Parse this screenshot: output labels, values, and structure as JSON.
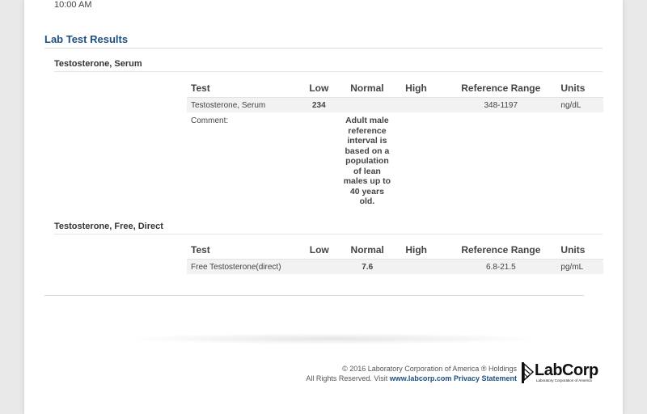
{
  "header": {
    "time": "10:00 AM"
  },
  "section": {
    "title": "Lab Test Results"
  },
  "columns": {
    "test": "Test",
    "low": "Low",
    "normal": "Normal",
    "high": "High",
    "reference": "Reference Range",
    "units": "Units"
  },
  "tests": [
    {
      "name": "Testosterone, Serum",
      "row": {
        "test": "Testosterone, Serum",
        "low": "234",
        "normal": "",
        "high": "",
        "reference": "348-1197",
        "units": "ng/dL"
      },
      "comment_label": "Comment:",
      "comment": "Adult male reference interval is based on a population of lean males up to 40 years old."
    },
    {
      "name": "Testosterone, Free, Direct",
      "row": {
        "test": "Free Testosterone(direct)",
        "low": "",
        "normal": "7.6",
        "high": "",
        "reference": "6.8-21.5",
        "units": "pg/mL"
      }
    }
  ],
  "footer": {
    "copyright": "© 2016 Laboratory Corporation of America ® Holdings",
    "rights": "All Rights Reserved. Visit",
    "link": "www.labcorp.com",
    "privacy": "Privacy Statement",
    "logo_text": "LabCorp",
    "logo_sub": "Laboratory Corporation of America"
  },
  "colors": {
    "accent": "#1e4f80",
    "background": "#e9e9e9",
    "row_shade": "#f2f2f2"
  },
  "icons": {
    "logo": "labcorp-logo-icon"
  }
}
